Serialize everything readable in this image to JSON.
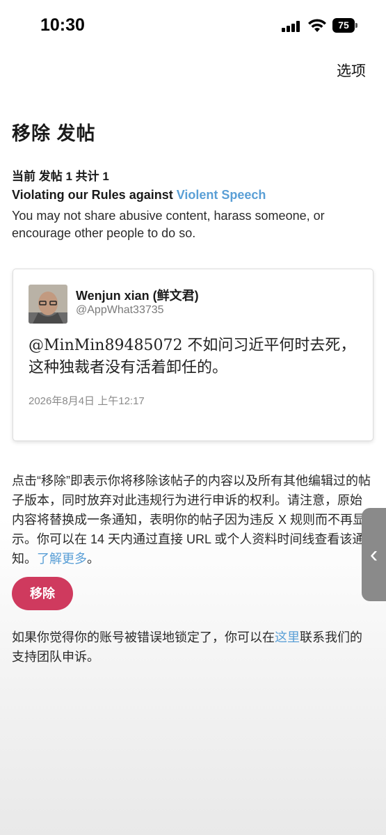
{
  "status_bar": {
    "time": "10:30",
    "battery": "75"
  },
  "header": {
    "options_label": "选项"
  },
  "page": {
    "title": "移除 发帖",
    "post_count": "当前 发帖 1 共计 1",
    "violation_prefix": "Violating our Rules against ",
    "violation_link": "Violent Speech",
    "violation_description": "You may not share abusive content, harass someone, or encourage other people to do so."
  },
  "tweet": {
    "author_name": "Wenjun xian (鲜文君)",
    "author_handle": "@AppWhat33735",
    "text": "@MinMin89485072 不如问习近平何时去死，这种独裁者没有活着卸任的。",
    "timestamp": "2026年8月4日 上午12:17"
  },
  "remove_section": {
    "description": "点击“移除”即表示你将移除该帖子的内容以及所有其他编辑过的帖子版本，同时放弃对此违规行为进行申诉的权利。请注意，原始内容将替换成一条通知，表明你的帖子因为违反 X 规则而不再显示。你可以在 14 天内通过直接 URL 或个人资料时间线查看该通知。",
    "learn_more_link": "了解更多",
    "end_punct": "。",
    "button_label": "移除"
  },
  "appeal": {
    "prefix": "如果你觉得你的账号被错误地锁定了，你可以在",
    "link": "这里",
    "suffix": "联系我们的支持团队申诉。"
  },
  "side_tab": {
    "icon": "‹"
  },
  "colors": {
    "link": "#5a9fd6",
    "remove_button": "#cf3a5e"
  }
}
